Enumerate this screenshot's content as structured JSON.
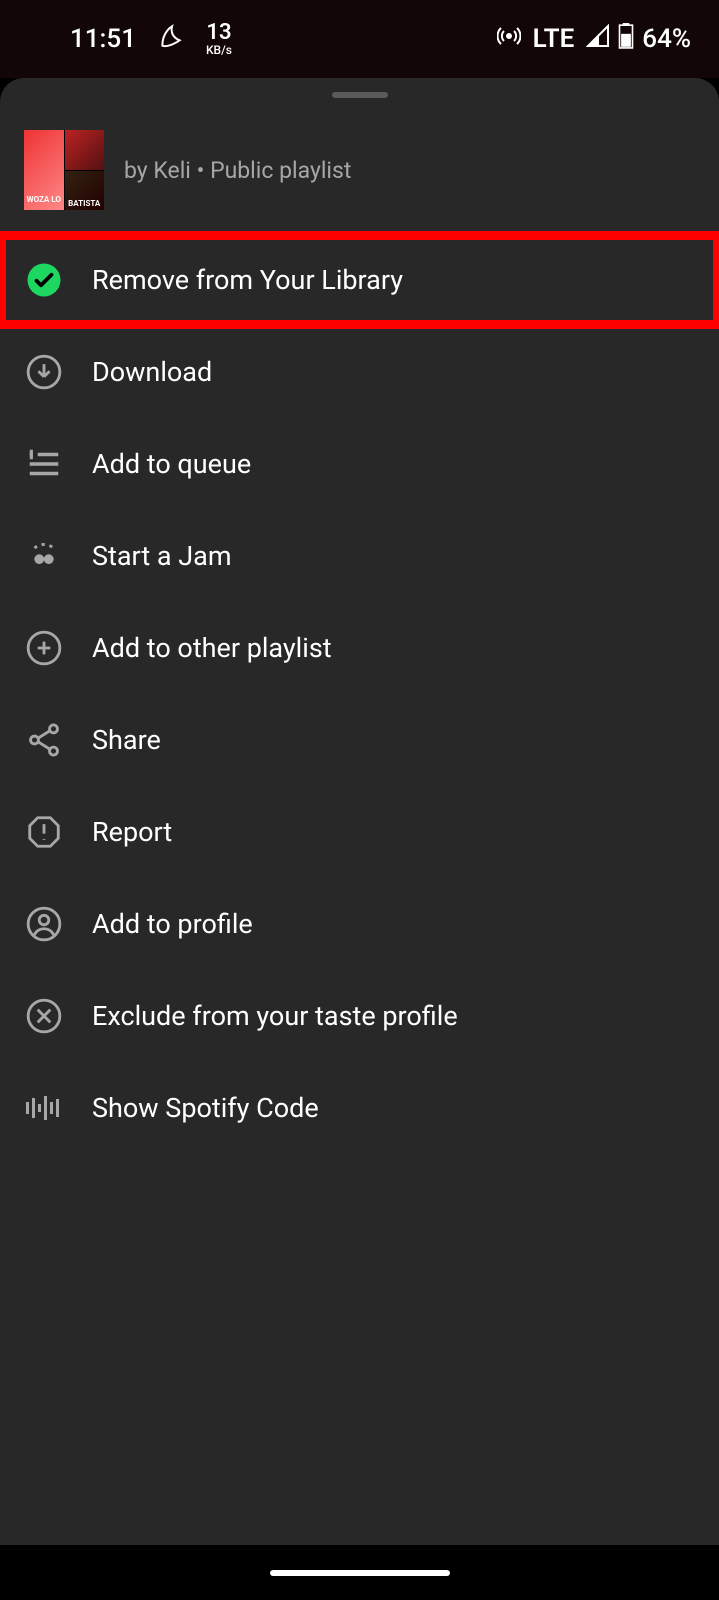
{
  "status": {
    "time": "11:51",
    "kbps_num": "13",
    "kbps_unit": "KB/s",
    "network": "LTE",
    "battery": "64%"
  },
  "header": {
    "meta": "by Keli • Public playlist",
    "cover_woza": "WOZA LO",
    "cover_batista": "BATISTA"
  },
  "menu": [
    {
      "label": "Remove from Your Library",
      "highlighted": true,
      "icon": "check-circle"
    },
    {
      "label": "Download",
      "highlighted": false,
      "icon": "download"
    },
    {
      "label": "Add to queue",
      "highlighted": false,
      "icon": "queue"
    },
    {
      "label": "Start a Jam",
      "highlighted": false,
      "icon": "jam"
    },
    {
      "label": "Add to other playlist",
      "highlighted": false,
      "icon": "add-circle"
    },
    {
      "label": "Share",
      "highlighted": false,
      "icon": "share"
    },
    {
      "label": "Report",
      "highlighted": false,
      "icon": "report"
    },
    {
      "label": "Add to profile",
      "highlighted": false,
      "icon": "profile"
    },
    {
      "label": "Exclude from your taste profile",
      "highlighted": false,
      "icon": "exclude"
    },
    {
      "label": "Show Spotify Code",
      "highlighted": false,
      "icon": "code"
    }
  ]
}
